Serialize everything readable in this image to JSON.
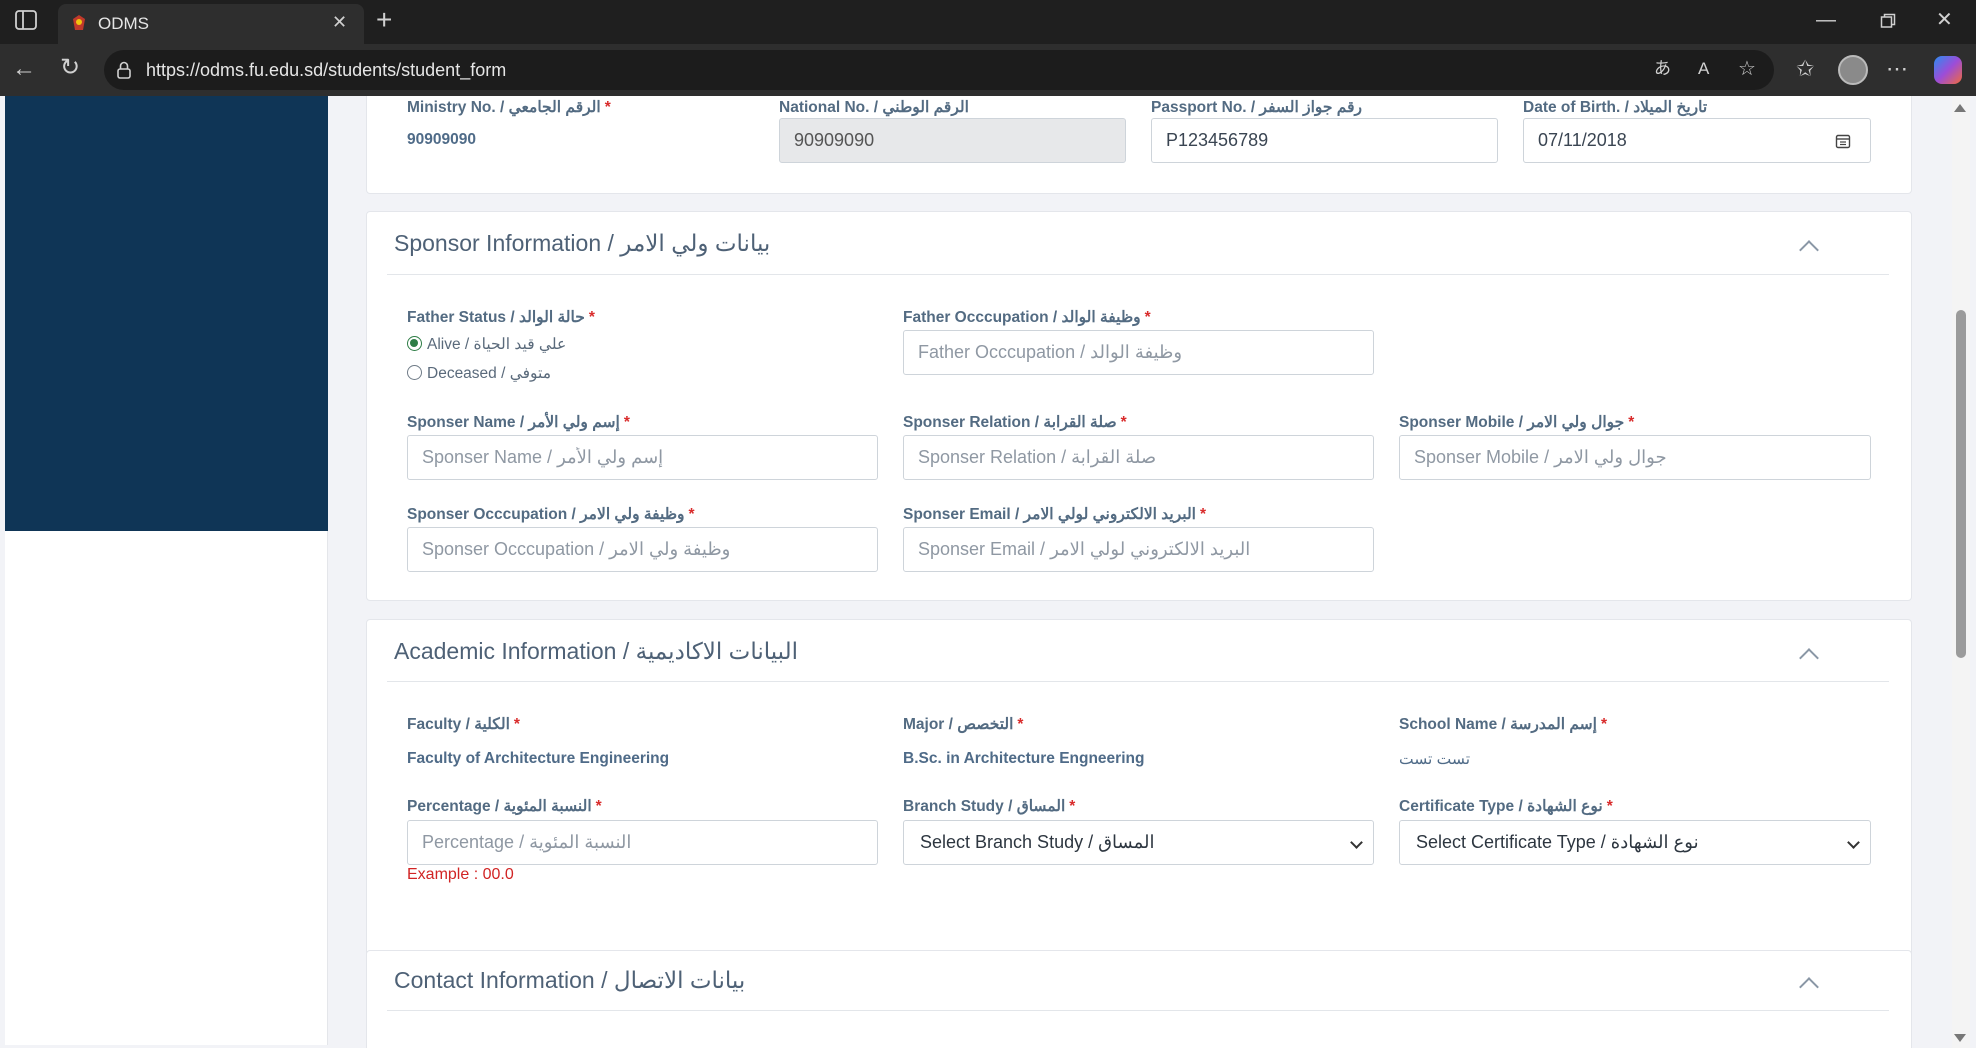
{
  "browser": {
    "tab_title": "ODMS",
    "new_tab": "+",
    "url": "https://odms.fu.edu.sd/students/student_form"
  },
  "personal": {
    "ministry_label": "Ministry No. / الرقم الجامعي",
    "ministry_value": "90909090",
    "national_label": "National No. / الرقم الوطني",
    "national_value": "90909090",
    "passport_label": "Passport No. / رقم جواز السفر",
    "passport_value": "P123456789",
    "dob_label": "Date of Birth. / تاريخ الميلاد",
    "dob_value": "07/11/2018"
  },
  "sponsor": {
    "title": "Sponsor Information / بيانات ولي الامر",
    "father_status_label": "Father Status / حالة الوالد",
    "alive_label": "Alive / علي قيد الحياة",
    "deceased_label": "Deceased / متوفي",
    "father_occupation_label": "Father Occcupation / وظيفة الوالد",
    "father_occupation_placeholder": "Father Occcupation / وظيفة الوالد",
    "name_label": "Sponser Name / إسم ولي الأمر",
    "name_placeholder": "Sponser Name / إسم ولي الأمر",
    "relation_label": "Sponser Relation / صلة القرابة",
    "relation_placeholder": "Sponser Relation / صلة القرابة",
    "mobile_label": "Sponser Mobile / جوال ولي الامر",
    "mobile_placeholder": "Sponser Mobile / جوال ولي الامر",
    "occupation_label": "Sponser Occcupation / وظيفة ولي الامر",
    "occupation_placeholder": "Sponser Occcupation / وظيفة ولي الامر",
    "email_label": "Sponser Email / البريد الالكتروني لولي الامر",
    "email_placeholder": "Sponser Email / البريد الالكتروني لولي الامر"
  },
  "academic": {
    "title": "Academic Information / البيانات الاكاديمية",
    "faculty_label": "Faculty / الكلية",
    "faculty_value": "Faculty of Architecture Engineering",
    "major_label": "Major / التخصص",
    "major_value": "B.Sc. in Architecture Engneering",
    "school_label": "School Name / إسم المدرسة",
    "school_value": "تست تست",
    "percentage_label": "Percentage / النسبة المئوية",
    "percentage_placeholder": "Percentage / النسبة المئوية",
    "percentage_hint": "Example : 00.0",
    "branch_label": "Branch Study / المساق",
    "branch_value": "Select Branch Study / المساق",
    "certificate_label": "Certificate Type / نوع الشهادة",
    "certificate_value": "Select Certificate Type / نوع الشهادة"
  },
  "contact": {
    "title": "Contact Information / بيانات الاتصال"
  },
  "required_mark": "*",
  "icons": [
    "sidebar-toggle-icon",
    "app-favicon-icon",
    "close-tab-icon",
    "minimize-icon",
    "restore-icon",
    "close-window-icon",
    "back-icon",
    "reload-icon",
    "lock-icon",
    "translate-icon",
    "read-aloud-icon",
    "star-icon",
    "favorites-icon",
    "profile-icon",
    "more-icon",
    "copilot-icon",
    "calendar-icon",
    "chevron-up-icon"
  ]
}
